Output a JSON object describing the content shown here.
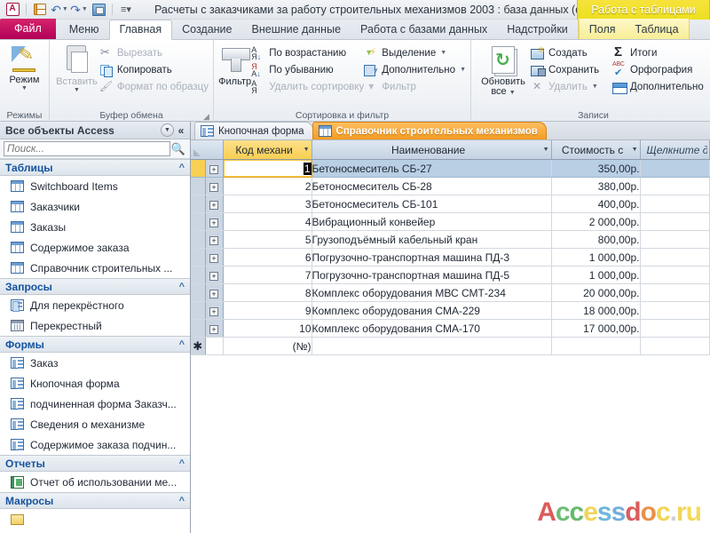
{
  "titlebar": {
    "app_icon": "access-logo-icon",
    "quick_access": [
      {
        "name": "save-icon",
        "label": "Сохранить"
      },
      {
        "name": "undo-icon",
        "label": "Отменить"
      },
      {
        "name": "redo-icon",
        "label": "Вернуть"
      },
      {
        "name": "refresh-all-icon",
        "label": "Обновить"
      },
      {
        "name": "customize-qat-icon",
        "label": "Настройка панели быстрого доступа"
      }
    ],
    "document_title": "Расчеты с заказчиками за работу строительных механизмов 2003 : база данных (ф...",
    "contextual_tab_title": "Работа с таблицами"
  },
  "ribbon_tabs": {
    "file": "Файл",
    "items": [
      {
        "label": "Меню",
        "active": false,
        "contextual": false
      },
      {
        "label": "Главная",
        "active": true,
        "contextual": false
      },
      {
        "label": "Создание",
        "active": false,
        "contextual": false
      },
      {
        "label": "Внешние данные",
        "active": false,
        "contextual": false
      },
      {
        "label": "Работа с базами данных",
        "active": false,
        "contextual": false
      },
      {
        "label": "Надстройки",
        "active": false,
        "contextual": false
      }
    ],
    "contextual": [
      {
        "label": "Поля"
      },
      {
        "label": "Таблица"
      }
    ]
  },
  "ribbon": {
    "groups": [
      {
        "name": "views",
        "label": "Режимы",
        "big_button": {
          "label": "Режим",
          "icon": "view-mode-icon",
          "has_dropdown": true
        }
      },
      {
        "name": "clipboard",
        "label": "Буфер обмена",
        "has_dialog_launcher": true,
        "big_button": {
          "label": "Вставить",
          "icon": "paste-icon",
          "disabled": true,
          "has_dropdown": true
        },
        "small_buttons": [
          {
            "label": "Вырезать",
            "icon": "scissors-icon",
            "disabled": true
          },
          {
            "label": "Копировать",
            "icon": "copy-icon",
            "disabled": false
          },
          {
            "label": "Формат по образцу",
            "icon": "format-painter-icon",
            "disabled": true
          }
        ]
      },
      {
        "name": "sort-filter",
        "label": "Сортировка и фильтр",
        "big_button": {
          "label": "Фильтр",
          "icon": "funnel-icon"
        },
        "column_a": [
          {
            "label": "По возрастанию",
            "icon": "sort-ascending-icon",
            "disabled": false
          },
          {
            "label": "По убыванию",
            "icon": "sort-descending-icon",
            "disabled": false
          },
          {
            "label": "Удалить сортировку",
            "icon": "clear-sort-icon",
            "disabled": true
          }
        ],
        "column_b": [
          {
            "label": "Выделение",
            "icon": "selection-icon",
            "has_dropdown": true,
            "disabled": false
          },
          {
            "label": "Дополнительно",
            "icon": "advanced-filter-icon",
            "has_dropdown": true,
            "disabled": false
          },
          {
            "label": "Фильтр",
            "icon": "toggle-filter-icon",
            "disabled": true
          }
        ]
      },
      {
        "name": "records",
        "label": "Записи",
        "big_button": {
          "label1": "Обновить",
          "label2": "все",
          "icon": "refresh-all-icon",
          "has_dropdown": true
        },
        "column_a": [
          {
            "label": "Создать",
            "icon": "new-record-icon",
            "disabled": false
          },
          {
            "label": "Сохранить",
            "icon": "save-record-icon",
            "disabled": false
          },
          {
            "label": "Удалить",
            "icon": "delete-record-icon",
            "has_dropdown": true,
            "disabled": true
          }
        ],
        "column_b": [
          {
            "label": "Итоги",
            "icon": "totals-sigma-icon",
            "disabled": false
          },
          {
            "label": "Орфография",
            "icon": "spelling-icon",
            "disabled": false
          },
          {
            "label": "Дополнительно",
            "icon": "more-records-icon",
            "disabled": false
          }
        ]
      }
    ]
  },
  "navigation_pane": {
    "header": "Все объекты Access",
    "header_menu_icon": "chevron-down-circle-icon",
    "collapse_icon": "double-chevron-left-icon",
    "search_placeholder": "Поиск...",
    "search_value": "",
    "search_icon": "search-icon",
    "groups": [
      {
        "title": "Таблицы",
        "icon_type": "table",
        "items": [
          {
            "label": "Switchboard Items"
          },
          {
            "label": "Заказчики"
          },
          {
            "label": "Заказы"
          },
          {
            "label": "Содержимое заказа"
          },
          {
            "label": "Справочник строительных ..."
          }
        ]
      },
      {
        "title": "Запросы",
        "icon_type": "query",
        "items": [
          {
            "label": "Для перекрёстного",
            "icon_type": "query"
          },
          {
            "label": "Перекрестный",
            "icon_type": "query2"
          }
        ]
      },
      {
        "title": "Формы",
        "icon_type": "form",
        "items": [
          {
            "label": "Заказ"
          },
          {
            "label": "Кнопочная форма"
          },
          {
            "label": "подчиненная форма Заказч..."
          },
          {
            "label": "Сведения о механизме"
          },
          {
            "label": "Содержимое заказа подчин..."
          }
        ]
      },
      {
        "title": "Отчеты",
        "icon_type": "report",
        "items": [
          {
            "label": "Отчет об использовании ме..."
          }
        ]
      },
      {
        "title": "Макросы",
        "icon_type": "macro",
        "items": []
      }
    ]
  },
  "document_tabs": [
    {
      "label": "Кнопочная форма",
      "icon": "form-icon",
      "active": false
    },
    {
      "label": "Справочник строительных механизмов",
      "icon": "table-icon",
      "active": true
    }
  ],
  "datasheet": {
    "columns": [
      {
        "key": "id",
        "header": "Код механи",
        "align": "left",
        "selected": true,
        "has_dropdown": true
      },
      {
        "key": "name",
        "header": "Наименование",
        "align": "center",
        "selected": false,
        "has_dropdown": true
      },
      {
        "key": "cost",
        "header": "Стоимость с",
        "align": "left",
        "selected": false,
        "has_dropdown": true
      },
      {
        "key": "addnew",
        "header": "Щелкните для",
        "align": "left",
        "selected": false,
        "has_dropdown": false
      }
    ],
    "rows": [
      {
        "id": "1",
        "name": "Бетоносмеситель СБ-27",
        "cost": "350,00р.",
        "selected": true
      },
      {
        "id": "2",
        "name": "Бетоносмеситель СБ-28",
        "cost": "380,00р.",
        "selected": false
      },
      {
        "id": "3",
        "name": "Бетоносмеситель СБ-101",
        "cost": "400,00р.",
        "selected": false
      },
      {
        "id": "4",
        "name": "Вибрационный конвейер",
        "cost": "2 000,00р.",
        "selected": false
      },
      {
        "id": "5",
        "name": "Грузоподъёмный кабельный кран",
        "cost": "800,00р.",
        "selected": false
      },
      {
        "id": "6",
        "name": "Погрузочно-транспортная машина ПД-3",
        "cost": "1 000,00р.",
        "selected": false
      },
      {
        "id": "7",
        "name": "Погрузочно-транспортная машина ПД-5",
        "cost": "1 000,00р.",
        "selected": false
      },
      {
        "id": "8",
        "name": "Комплекс оборудования МВС СМТ-234",
        "cost": "20 000,00р.",
        "selected": false
      },
      {
        "id": "9",
        "name": "Комплекс оборудования  СМА-229",
        "cost": "18 000,00р.",
        "selected": false
      },
      {
        "id": "10",
        "name": "Комплекс оборудования  СМА-170",
        "cost": "17 000,00р.",
        "selected": false
      }
    ],
    "new_row": {
      "id": "(№)",
      "name": "",
      "cost": ""
    },
    "expand_glyph": "+",
    "new_record_glyph": "✱"
  },
  "watermark": {
    "text": "Accessdoc.ru",
    "letters": [
      {
        "ch": "A",
        "color": "#d94f4f"
      },
      {
        "ch": "c",
        "color": "#63b86a"
      },
      {
        "ch": "c",
        "color": "#5bb560"
      },
      {
        "ch": "e",
        "color": "#efd24a"
      },
      {
        "ch": "s",
        "color": "#63b0d8"
      },
      {
        "ch": "s",
        "color": "#6aa8d9"
      },
      {
        "ch": "d",
        "color": "#d94f4f"
      },
      {
        "ch": "o",
        "color": "#e8883c"
      },
      {
        "ch": "c",
        "color": "#efd24a"
      },
      {
        "ch": ".",
        "color": "#c9cdd2"
      },
      {
        "ch": "r",
        "color": "#efd24a"
      },
      {
        "ch": "u",
        "color": "#f2d84e"
      }
    ]
  },
  "colors": {
    "accent_orange": "#f59b22",
    "file_tab": "#b3005a",
    "contextual_yellow": "#ece01f",
    "selection_blue": "#b9cfe4",
    "nav_group_text": "#15539e"
  }
}
